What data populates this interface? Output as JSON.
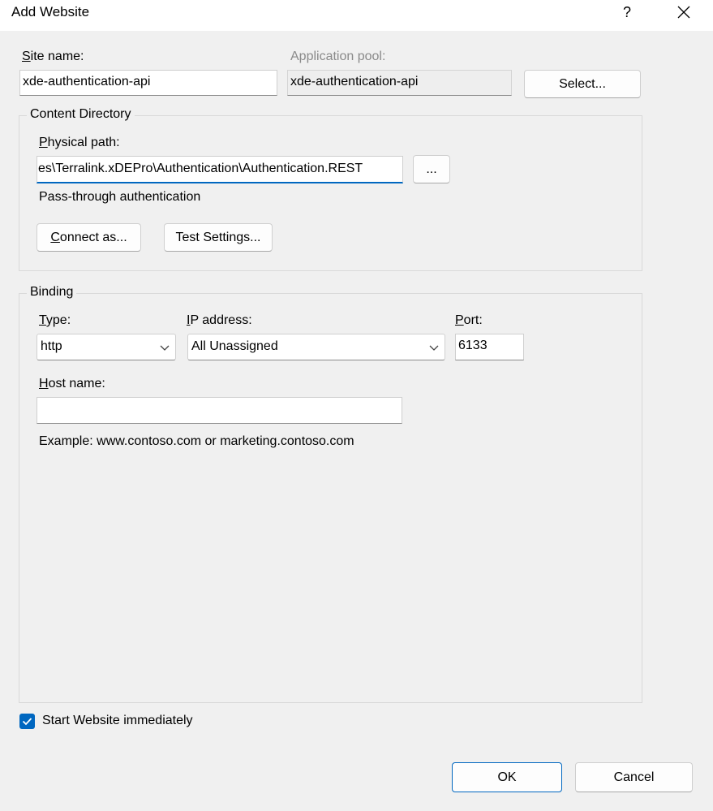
{
  "window": {
    "title": "Add Website",
    "help_label": "?"
  },
  "site": {
    "name_label": "Site name:",
    "name_value": "xde-authentication-api",
    "pool_label": "Application pool:",
    "pool_value": "xde-authentication-api",
    "select_label": "Select..."
  },
  "content": {
    "group_title": "Content Directory",
    "path_label": "Physical path:",
    "path_value": "es\\Terralink.xDEPro\\Authentication\\Authentication.REST",
    "browse_label": "...",
    "auth_text": "Pass-through authentication",
    "connect_label": "Connect as...",
    "test_label": "Test Settings..."
  },
  "binding": {
    "group_title": "Binding",
    "type_label": "Type:",
    "type_value": "http",
    "ip_label": "IP address:",
    "ip_value": "All Unassigned",
    "port_label": "Port:",
    "port_value": "6133",
    "host_label": "Host name:",
    "host_value": "",
    "example_text": "Example: www.contoso.com or marketing.contoso.com"
  },
  "start": {
    "label": "Start Website immediately",
    "checked": true
  },
  "footer": {
    "ok_label": "OK",
    "cancel_label": "Cancel"
  },
  "colors": {
    "accent": "#0067c0",
    "background": "#f0f0f0"
  }
}
